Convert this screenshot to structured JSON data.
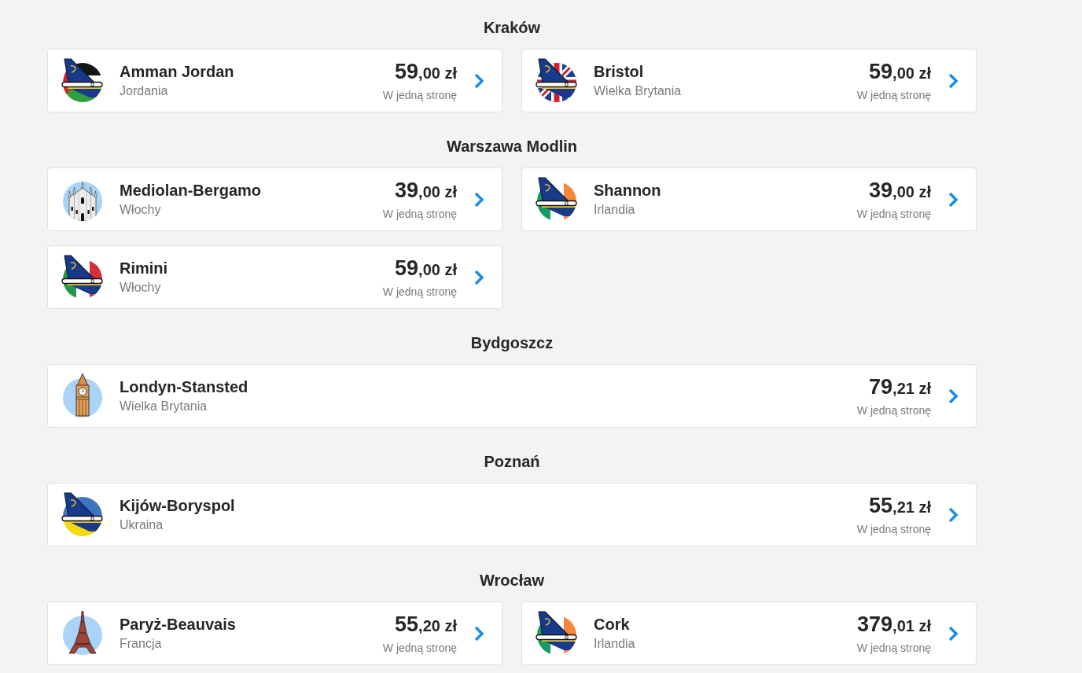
{
  "sections": [
    {
      "origin": "Kraków",
      "destinations": [
        {
          "kind": "jordan",
          "city": "Amman Jordan",
          "country": "Jordania",
          "price": {
            "whole": "59",
            "rest": ",00 zł"
          },
          "fare_type": "W jedną stronę"
        },
        {
          "kind": "uk",
          "city": "Bristol",
          "country": "Wielka Brytania",
          "price": {
            "whole": "59",
            "rest": ",00 zł"
          },
          "fare_type": "W jedną stronę"
        }
      ]
    },
    {
      "origin": "Warszawa Modlin",
      "destinations": [
        {
          "kind": "milan",
          "city": "Mediolan-Bergamo",
          "country": "Włochy",
          "price": {
            "whole": "39",
            "rest": ",00 zł"
          },
          "fare_type": "W jedną stronę"
        },
        {
          "kind": "ireland",
          "city": "Shannon",
          "country": "Irlandia",
          "price": {
            "whole": "39",
            "rest": ",00 zł"
          },
          "fare_type": "W jedną stronę"
        },
        {
          "kind": "italy",
          "city": "Rimini",
          "country": "Włochy",
          "price": {
            "whole": "59",
            "rest": ",00 zł"
          },
          "fare_type": "W jedną stronę"
        }
      ]
    },
    {
      "origin": "Bydgoszcz",
      "destinations": [
        {
          "kind": "london",
          "city": "Londyn-Stansted",
          "country": "Wielka Brytania",
          "price": {
            "whole": "79",
            "rest": ",21 zł"
          },
          "fare_type": "W jedną stronę"
        }
      ]
    },
    {
      "origin": "Poznań",
      "destinations": [
        {
          "kind": "ukraine",
          "city": "Kijów-Boryspol",
          "country": "Ukraina",
          "price": {
            "whole": "55",
            "rest": ",21 zł"
          },
          "fare_type": "W jedną stronę"
        }
      ]
    },
    {
      "origin": "Wrocław",
      "destinations": [
        {
          "kind": "paris",
          "city": "Paryż-Beauvais",
          "country": "Francja",
          "price": {
            "whole": "55",
            "rest": ",20 zł"
          },
          "fare_type": "W jedną stronę"
        },
        {
          "kind": "ireland",
          "city": "Cork",
          "country": "Irlandia",
          "price": {
            "whole": "379",
            "rest": ",01 zł"
          },
          "fare_type": "W jedną stronę"
        }
      ]
    }
  ]
}
